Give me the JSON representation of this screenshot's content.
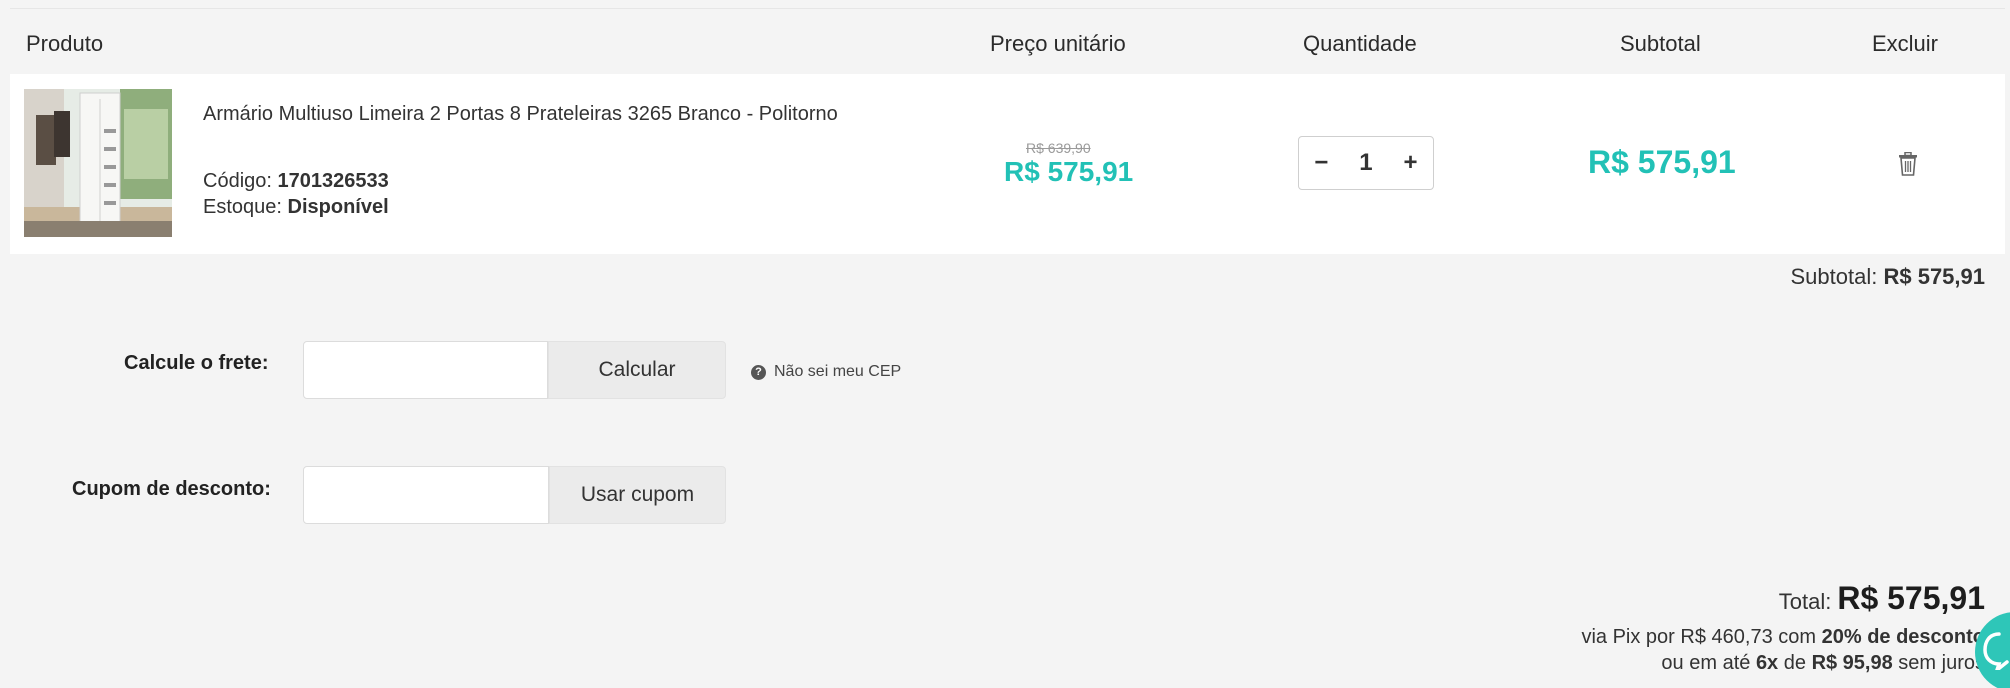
{
  "table": {
    "headers": {
      "product": "Produto",
      "unit_price": "Preço unitário",
      "quantity": "Quantidade",
      "subtotal": "Subtotal",
      "delete": "Excluir"
    },
    "item": {
      "name": "Armário Multiuso Limeira 2 Portas 8 Prateleiras 3265 Branco - Politorno",
      "code_label": "Código:",
      "code_value": "1701326533",
      "stock_label": "Estoque:",
      "stock_value": "Disponível",
      "old_price": "R$ 639,90",
      "unit_price": "R$ 575,91",
      "quantity": "1",
      "minus": "−",
      "plus": "+",
      "subtotal": "R$ 575,91"
    }
  },
  "summary": {
    "subtotal_label": "Subtotal:",
    "subtotal_value": "R$ 575,91",
    "freight_label": "Calcule o frete:",
    "freight_button": "Calcular",
    "cep_link": "Não sei meu CEP",
    "coupon_label": "Cupom de desconto:",
    "coupon_button": "Usar cupom",
    "total_label": "Total:",
    "total_value": "R$ 575,91",
    "pix": {
      "prefix": "via Pix por",
      "value": "R$ 460,73",
      "middle": "com",
      "discount": "20% de desconto"
    },
    "installments": {
      "prefix": "ou em até",
      "count": "6x",
      "middle": "de",
      "value": "R$ 95,98",
      "suffix": "sem juros"
    }
  },
  "colors": {
    "accent": "#22c1b6",
    "background": "#f4f4f4"
  },
  "icons": {
    "delete": "trash-icon",
    "help": "question-circle-icon",
    "chat": "chat-bubble-icon"
  }
}
